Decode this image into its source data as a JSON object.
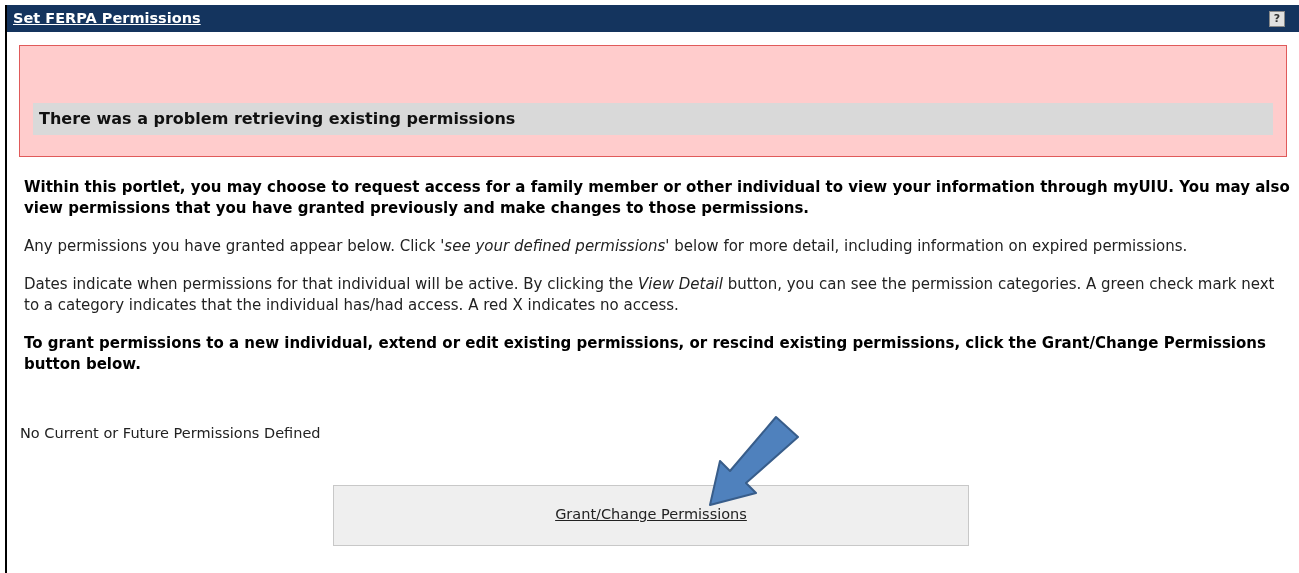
{
  "portlet": {
    "title": "Set FERPA Permissions",
    "help_label": "?"
  },
  "error": {
    "message": "There was a problem retrieving existing permissions"
  },
  "paragraphs": [
    {
      "kind": "bold",
      "text": "Within this portlet, you may choose to request access for a family member or other individual to view your information through myUIU. You may also view permissions that you have granted previously and make changes to those permissions."
    },
    {
      "kind": "normal",
      "text": "Any permissions you have granted appear below. Click *'see your defined permissions'* below for more detail, including information on expired permissions."
    },
    {
      "kind": "normal",
      "text": "Dates indicate when permissions for that individual will be active. By clicking the *View Detail* button, you can see the permission categories. A green check mark next to a category indicates that the individual has/had access. A red X indicates no access."
    },
    {
      "kind": "bold",
      "text": "To grant permissions to a new individual, extend or edit existing permissions, or rescind existing permissions, click the Grant/Change Permissions button below."
    }
  ],
  "status": "No Current or Future Permissions Defined",
  "button": {
    "label": "Grant/Change Permissions"
  }
}
